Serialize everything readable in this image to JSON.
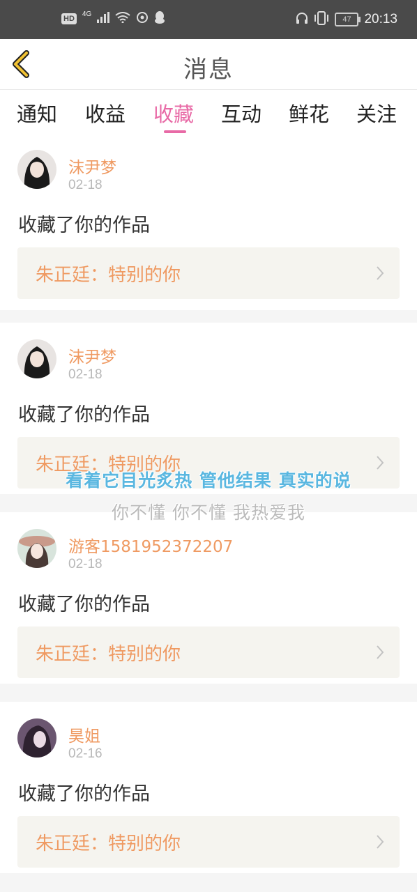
{
  "statusbar": {
    "hd": "HD",
    "network": "4G",
    "battery": "47",
    "time": "20:13",
    "icons": [
      "signal-icon",
      "wifi-icon",
      "sync-icon",
      "qq-penguin-icon",
      "headset-icon",
      "vibrate-icon",
      "battery-icon"
    ]
  },
  "header": {
    "title": "消息",
    "back_icon": "chevron-left-icon",
    "accent": "#f1c233"
  },
  "tabs": {
    "items": [
      {
        "label": "通知"
      },
      {
        "label": "收益"
      },
      {
        "label": "收藏"
      },
      {
        "label": "互动"
      },
      {
        "label": "鲜花"
      },
      {
        "label": "关注"
      }
    ],
    "active_index": 2,
    "active_color": "#e86aa6"
  },
  "cards": [
    {
      "user": "沫尹梦",
      "date": "02-18",
      "action": "收藏了你的作品",
      "work": "朱正廷：特别的你"
    },
    {
      "user": "沫尹梦",
      "date": "02-18",
      "action": "收藏了你的作品",
      "work": "朱正廷：特别的你"
    },
    {
      "user": "游客1581952372207",
      "date": "02-18",
      "action": "收藏了你的作品",
      "work": "朱正廷：特别的你"
    },
    {
      "user": "昊姐",
      "date": "02-16",
      "action": "收藏了你的作品",
      "work": "朱正廷：特别的你"
    }
  ],
  "lyrics": {
    "line1": "看着它目光炙热 管他结果 真实的说",
    "line2": "你不懂 你不懂 我热爱我"
  },
  "colors": {
    "username": "#ef9a62",
    "work_bg": "#f5f4ef",
    "lyric_blue": "#5ab7e0"
  }
}
